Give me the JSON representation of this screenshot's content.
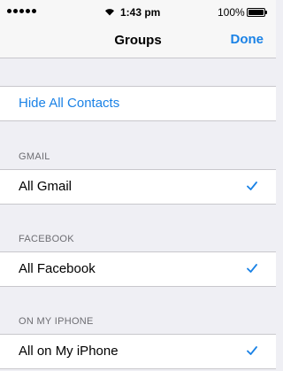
{
  "status": {
    "time": "1:43 pm",
    "battery": "100%",
    "battery_level": 1.0
  },
  "nav": {
    "title": "Groups",
    "done_label": "Done"
  },
  "hide_all": {
    "label": "Hide All Contacts"
  },
  "sections": [
    {
      "header": "GMAIL",
      "item": "All Gmail",
      "checked": true
    },
    {
      "header": "FACEBOOK",
      "item": "All Facebook",
      "checked": true
    },
    {
      "header": "ON MY IPHONE",
      "item": "All on My iPhone",
      "checked": true
    }
  ],
  "colors": {
    "accent": "#1a82e6",
    "background": "#efeff4",
    "separator": "#c8c7cc",
    "section_header_text": "#6d6d72"
  }
}
